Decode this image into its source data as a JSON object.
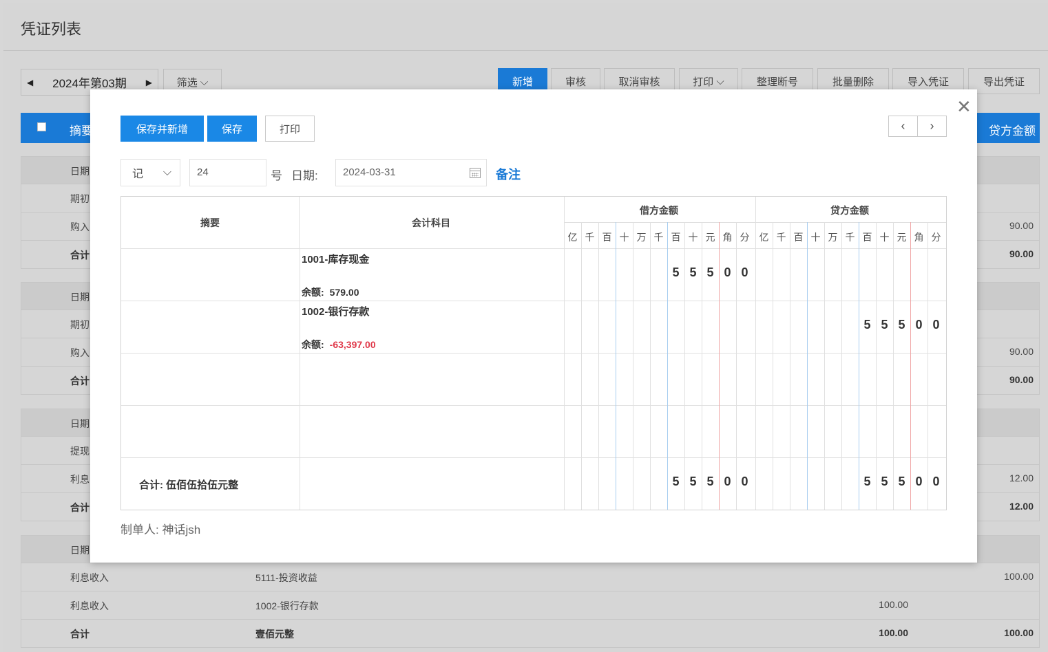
{
  "page": {
    "title": "凭证列表",
    "period_label": "2024年第03期",
    "filter_label": "筛选",
    "toolbar": [
      "新增",
      "审核",
      "取消审核",
      "打印",
      "整理断号",
      "批量删除",
      "导入凭证",
      "导出凭证"
    ],
    "table_header": {
      "summary": "摘要",
      "credit": "贷方金额"
    },
    "groups": [
      {
        "head": "日期",
        "rows": [
          {
            "c1": "期初",
            "c2": "",
            "c3": "",
            "c4": ""
          },
          {
            "c1": "购入",
            "c2": "",
            "c3": "",
            "c4": "90.00"
          },
          {
            "c1": "合计",
            "c2": "",
            "c3": "",
            "c4": "90.00",
            "bold": true
          }
        ]
      },
      {
        "head": "日期",
        "rows": [
          {
            "c1": "期初",
            "c2": "",
            "c3": "",
            "c4": ""
          },
          {
            "c1": "购入",
            "c2": "",
            "c3": "",
            "c4": "90.00"
          },
          {
            "c1": "合计",
            "c2": "",
            "c3": "",
            "c4": "90.00",
            "bold": true
          }
        ]
      },
      {
        "head": "日期",
        "rows": [
          {
            "c1": "提现",
            "c2": "",
            "c3": "",
            "c4": ""
          },
          {
            "c1": "利息",
            "c2": "",
            "c3": "",
            "c4": "12.00"
          },
          {
            "c1": "合计",
            "c2": "",
            "c3": "",
            "c4": "12.00",
            "bold": true
          }
        ]
      },
      {
        "head": "日期",
        "rows": [
          {
            "c1": "利息收入",
            "c2": "5111-投资收益",
            "c3": "",
            "c4": "100.00"
          },
          {
            "c1": "利息收入",
            "c2": "1002-银行存款",
            "c3": "100.00",
            "c4": ""
          },
          {
            "c1": "合计",
            "c2": "壹佰元整",
            "c3": "100.00",
            "c4": "100.00",
            "bold": true
          }
        ]
      }
    ]
  },
  "modal": {
    "buttons": {
      "save_new": "保存并新增",
      "save": "保存",
      "print": "打印"
    },
    "voucher_type": "记",
    "voucher_no": "24",
    "hao_label": "号",
    "date_label": "日期:",
    "date_value": "2024-03-31",
    "remark_label": "备注",
    "grid": {
      "summary_header": "摘要",
      "account_header": "会计科目",
      "debit_header": "借方金额",
      "credit_header": "贷方金额",
      "units": [
        "亿",
        "千",
        "百",
        "十",
        "万",
        "千",
        "百",
        "十",
        "元",
        "角",
        "分"
      ],
      "balance_label": "余额:",
      "entries": [
        {
          "account": "1001-库存现金",
          "balance": "579.00",
          "negative": false,
          "debit": "55500",
          "credit": ""
        },
        {
          "account": "1002-银行存款",
          "balance": "-63,397.00",
          "negative": true,
          "debit": "",
          "credit": "55500"
        }
      ],
      "total_text": "合计: 伍佰伍拾伍元整",
      "total_debit": "55500",
      "total_credit": "55500"
    },
    "maker_label": "制单人:",
    "maker_name": "神话jsh"
  }
}
